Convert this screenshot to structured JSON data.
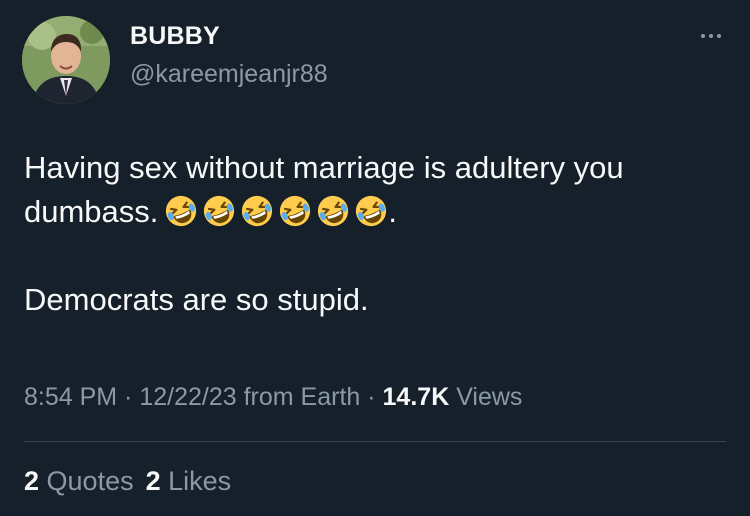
{
  "author": {
    "display_name": "BUBBY",
    "handle": "@kareemjeanjr88"
  },
  "tweet": {
    "line1": "Having sex without marriage is adultery you",
    "line2_text": "dumbass.",
    "line2_emoji": "🤣🤣🤣🤣🤣🤣",
    "line2_end": ".",
    "line3": "Democrats are so stupid."
  },
  "meta": {
    "time": "8:54 PM",
    "sep1": " · ",
    "date": "12/22/23",
    "source": " from Earth",
    "sep2": " · ",
    "views_count": "14.7K",
    "views_label": " Views"
  },
  "stats": {
    "quotes_count": "2",
    "quotes_label": " Quotes",
    "likes_count": "2",
    "likes_label": " Likes"
  },
  "icons": {
    "more": "more-horizontal-icon",
    "emoji": "rolling-on-floor-laughing-emoji"
  },
  "colors": {
    "background": "#15202b",
    "primary_text": "#f7f9f9",
    "secondary_text": "#8b98a5",
    "divider": "#38444d"
  }
}
